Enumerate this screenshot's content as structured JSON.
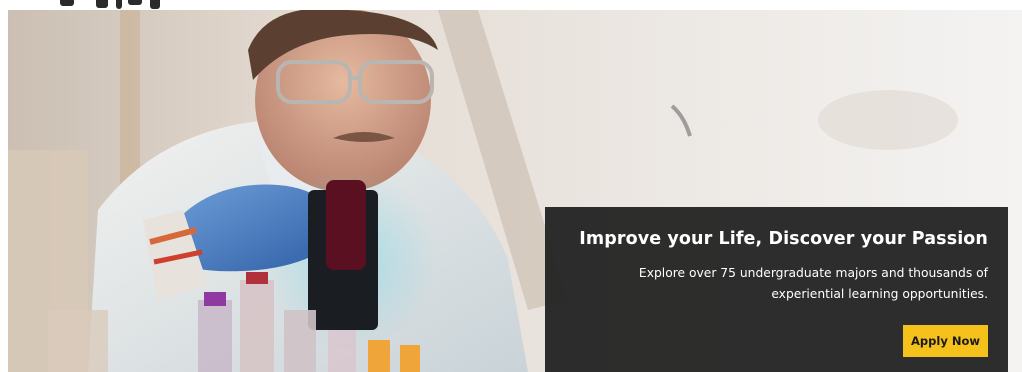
{
  "hero": {
    "image_alt": "Student in a lab coat and gloves handling sample vials",
    "title": "Improve your Life, Discover your Passion",
    "description_line1": "Explore over 75 undergraduate majors and thousands of",
    "description_line2": "experiential learning opportunities.",
    "cta_label": "Apply Now"
  },
  "colors": {
    "cta_background": "#f5c21b",
    "card_background": "#1e1e1e",
    "card_text": "#ffffff"
  }
}
